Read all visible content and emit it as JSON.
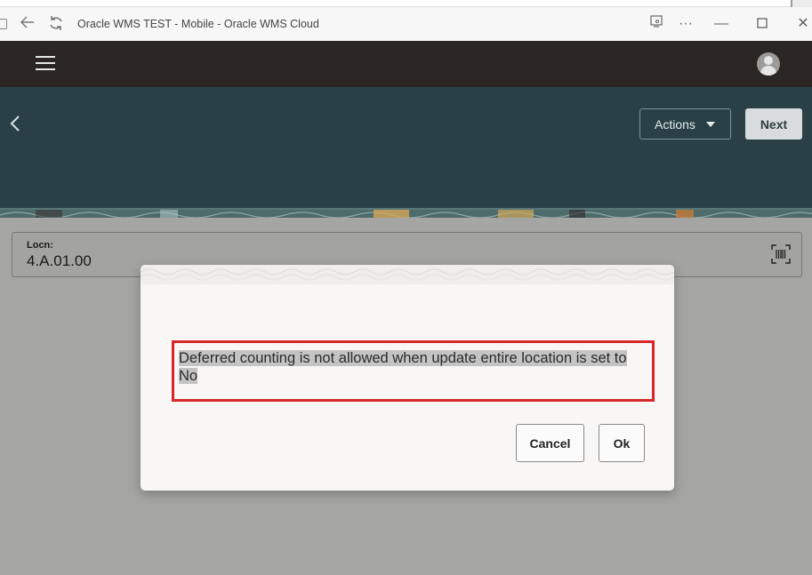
{
  "window": {
    "title": "Oracle WMS TEST - Mobile - Oracle WMS Cloud",
    "icons": [
      "app-icon",
      "back-arrow-icon",
      "refresh-icon",
      "cast-icon",
      "more-icon",
      "minimize-icon",
      "maximize-icon",
      "close-icon"
    ]
  },
  "appbar": {
    "menu_icon": "hamburger-icon",
    "avatar_icon": "user-avatar-icon"
  },
  "header": {
    "back_icon": "chevron-left-icon",
    "actions_label": "Actions",
    "next_label": "Next"
  },
  "form": {
    "locn_label": "Locn:",
    "locn_value": "4.A.01.00",
    "barcode_icon": "barcode-scan-icon"
  },
  "dialog": {
    "message_line1": "Deferred counting is not allowed when update entire location is set to",
    "message_line2": "No",
    "cancel_label": "Cancel",
    "ok_label": "Ok"
  },
  "colors": {
    "appbar_bg": "#2b2623",
    "header_bg": "#294146",
    "page_bg": "#a5a5a3",
    "highlight_border": "#d8262b"
  }
}
